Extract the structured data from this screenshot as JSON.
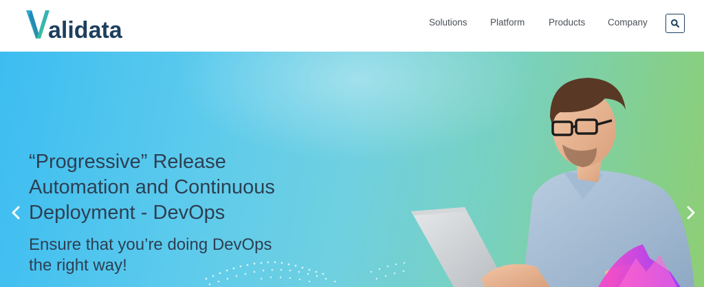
{
  "brand": {
    "name": "Validata",
    "logo_rest": "alidata",
    "colors": {
      "v_blue": "#2aa7d8",
      "v_green": "#3fc18f",
      "text": "#1d3f5e"
    }
  },
  "nav": {
    "items": [
      {
        "label": "Solutions"
      },
      {
        "label": "Platform"
      },
      {
        "label": "Products"
      },
      {
        "label": "Company"
      }
    ],
    "search_icon": "search-icon"
  },
  "hero": {
    "headline_lines": [
      "“Progressive” Release",
      "Automation and Continuous",
      "Deployment - DevOps"
    ],
    "subline_lines": [
      "Ensure that you’re doing DevOps",
      "the right way!"
    ],
    "prev_icon": "chevron-left-icon",
    "next_icon": "chevron-right-icon",
    "colors": {
      "gradient_start": "#3cbdf1",
      "gradient_end": "#8fce74",
      "headline": "#2d3f52"
    }
  }
}
